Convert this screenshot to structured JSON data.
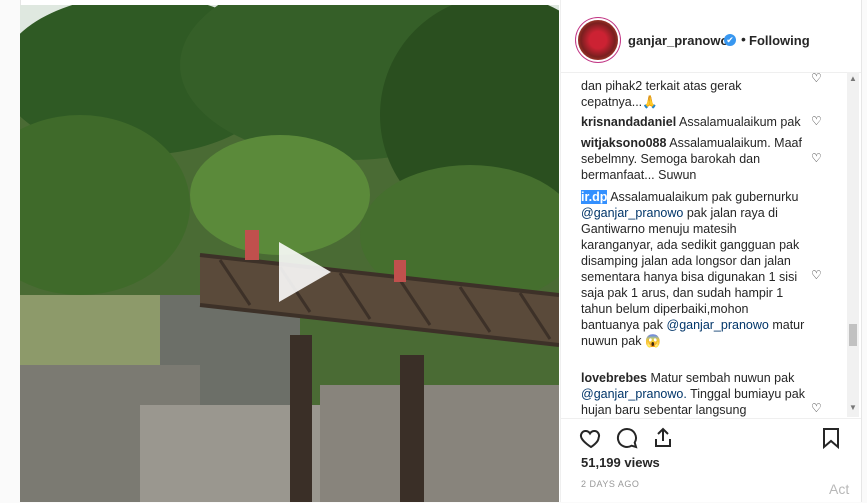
{
  "post": {
    "username": "ganjar_pranowo",
    "verified_mark": "✔",
    "separator": "•",
    "follow_status": "Following",
    "views": "51,199 views",
    "date": "2 DAYS AGO",
    "activate_hint": "Act"
  },
  "comments": [
    {
      "user": "",
      "text": "dan pihak2 terkait atas gerak cepatnya...🙏"
    },
    {
      "user": "krisnandadaniel",
      "text": "Assalamualaikum pak"
    },
    {
      "user": "witjaksono088",
      "text": "Assalamualaikum. Maaf sebelmny. Semoga barokah dan bermanfaat... Suwun"
    },
    {
      "user": "ir.dp",
      "text_a": "Assalamualaikum pak gubernurku",
      "mention_a": "@ganjar_pranowo",
      "text_b": "pak jalan raya di Gantiwarno menuju matesih karanganyar, ada sedikit gangguan pak disamping jalan ada longsor dan jalan sementara hanya bisa digunakan 1 sisi saja pak 1 arus, dan sudah hampir 1 tahun belum diperbaiki,mohon bantuanya pak",
      "mention_b": "@ganjar_pranowo",
      "text_c": "matur nuwun pak",
      "emoji": "😱"
    },
    {
      "user": "lovebrebes",
      "text_a": "Matur sembah nuwun pak",
      "mention_a": "@ganjar_pranowo.",
      "text_b": "Tinggal bumiayu pak hujan baru sebentar langsung"
    }
  ],
  "icons": {
    "like": "heart-icon",
    "comment": "comment-icon",
    "share": "share-icon",
    "save": "bookmark-icon",
    "comment_like": "heart-outline-icon"
  },
  "colors": {
    "link": "#003569",
    "verified": "#3897f0",
    "selection": "#3390ff"
  }
}
